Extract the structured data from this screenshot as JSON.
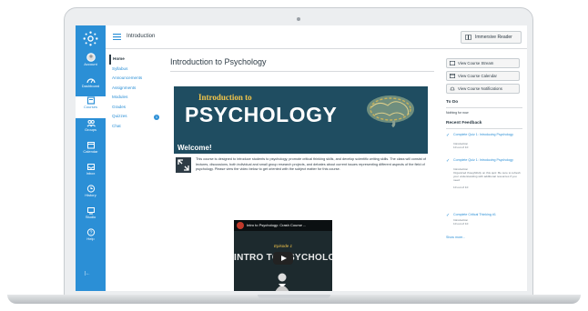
{
  "header": {
    "breadcrumb": "Introduction",
    "immersive_reader": "Immersive Reader"
  },
  "global_nav": [
    {
      "label": "Account",
      "icon": "account-icon"
    },
    {
      "label": "Dashboard",
      "icon": "dashboard-icon"
    },
    {
      "label": "Courses",
      "icon": "courses-icon"
    },
    {
      "label": "Groups",
      "icon": "groups-icon"
    },
    {
      "label": "Calendar",
      "icon": "calendar-icon"
    },
    {
      "label": "Inbox",
      "icon": "inbox-icon"
    },
    {
      "label": "History",
      "icon": "history-icon"
    },
    {
      "label": "Studio",
      "icon": "studio-icon"
    },
    {
      "label": "Help",
      "icon": "help-icon"
    }
  ],
  "course_nav": [
    "Home",
    "Syllabus",
    "Announcements",
    "Assignments",
    "Modules",
    "Grades",
    "Quizzes",
    "Chat"
  ],
  "grades_badge": "1",
  "page": {
    "title": "Introduction to Psychology",
    "banner_line1": "Introduction to",
    "banner_line2": "PSYCHOLOGY",
    "welcome": "Welcome!",
    "paragraph": "This course is designed to introduce students to psychology, promote critical thinking skills, and develop scientific writing skills. The class will consist of lectures, discussions, both individual and small group research projects, and debates about current issues representing different aspects of the field of psychology. Please view the video below to get oriented with the subject matter for this course."
  },
  "video": {
    "title": "Intro to Psychology: Crash Course ...",
    "episode": "Episode 1",
    "big_text": "INTRO TO PSYCHOLOGY"
  },
  "sidebar": {
    "buttons": [
      "View Course Stream",
      "View Course Calendar",
      "View Course Notifications"
    ],
    "todo_heading": "To Do",
    "todo_empty": "Nothing for now",
    "feedback_heading": "Recent Feedback",
    "feedback": [
      {
        "title": "Complete Quiz 1: Introducing Psychology",
        "sub": "Introduction",
        "score": "10 out of 10"
      },
      {
        "title": "Complete Quiz 1: Introducing Psychology",
        "sub": "Introduction",
        "note": "Organized thoughtfully on this quiz. Be sure to refresh your understanding with additional resources if you need",
        "score": "10 out of 10"
      },
      {
        "title": "Complete Critical Thinking #1",
        "sub": "Introduction",
        "score": "10 out of 10"
      }
    ],
    "more": "Show more..."
  },
  "colors": {
    "brand": "#2b8fd6",
    "banner": "#1f4d61",
    "banner_accent": "#f4c64a"
  }
}
